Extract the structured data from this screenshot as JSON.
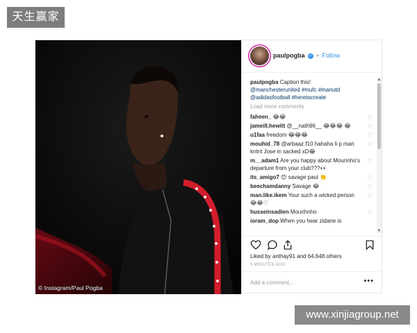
{
  "watermark_top": "天生赢家",
  "watermark_bottom": "www.xinjiagroup.net",
  "photo": {
    "credit": "© Instagram/Paul Pogba"
  },
  "post": {
    "username": "paulpogba",
    "verified_mark": "✓",
    "separator": "•",
    "follow_label": "Follow",
    "caption_user": "paulpogba",
    "caption_text": "Caption this!",
    "caption_tags": "@manchesterunited #mufc #manutd @adidasfootball #heretocreate",
    "load_more": "Load more comments",
    "comments": [
      {
        "user": "faheen_",
        "text": "😂😂"
      },
      {
        "user": "jameill.hewitt",
        "text": "@__nath96__ 😂😂😂 😂"
      },
      {
        "user": "u1faa",
        "text": "freedom 😂😂😂"
      },
      {
        "user": "mouhid_78",
        "text": "@arbaaz.f10 hahaha li p mari kntnt Jose in sacked xD😂"
      },
      {
        "user": "m__adam1",
        "text": "Are you happy about Mourinho's departure from your club???👀"
      },
      {
        "user": "its_amigo7",
        "text": "😊 savage paul 👏"
      },
      {
        "user": "beechamdanny",
        "text": "Savage 😂"
      },
      {
        "user": "man.like.ikem",
        "text": "Your such a wicked person 😂😂♡"
      },
      {
        "user": "husseinsadien",
        "text": "Mourihnho"
      },
      {
        "user": "ioram_dop",
        "text": "When you hear zidane is"
      }
    ],
    "likes_user": "anthay91",
    "likes_text": "Liked by anthay91 and 64,648 others",
    "time": "5 MINUTES AGO",
    "add_comment_placeholder": "Add a comment...",
    "more_label": "•••"
  },
  "icons": [
    "heart-icon",
    "comment-icon",
    "share-icon",
    "bookmark-icon"
  ]
}
